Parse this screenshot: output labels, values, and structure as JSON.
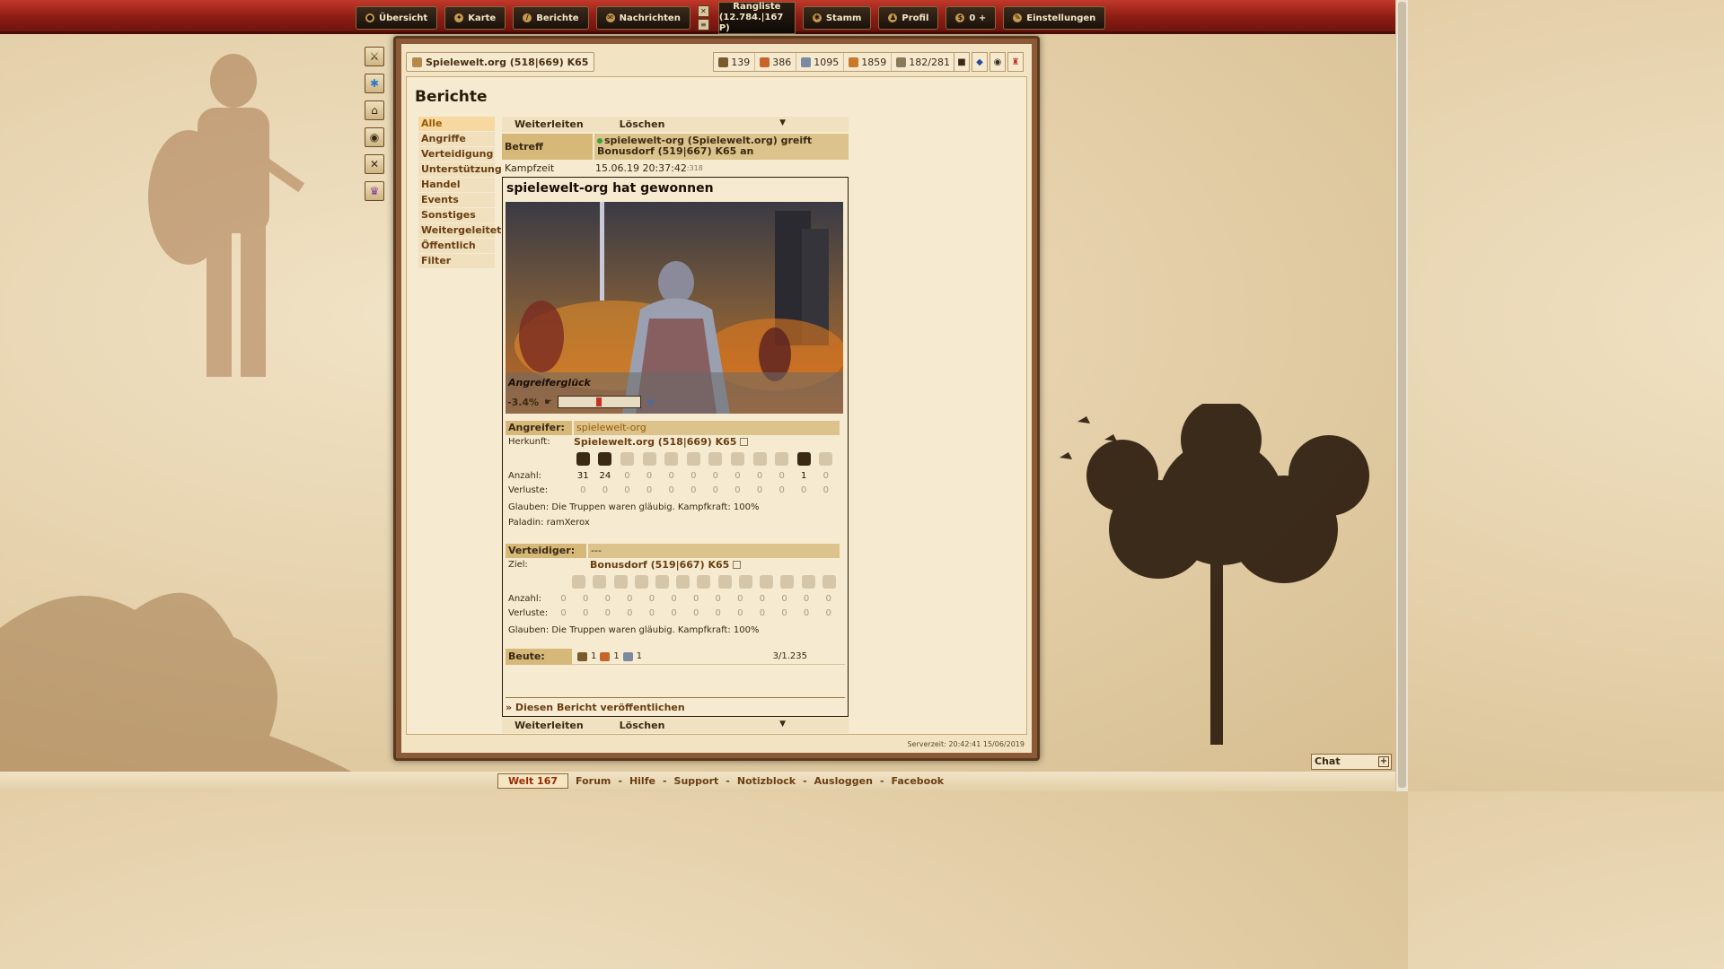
{
  "nav": {
    "overview": "Übersicht",
    "map": "Karte",
    "reports": "Berichte",
    "messages": "Nachrichten",
    "ranking_label": "Rangliste",
    "ranking_value": "(12.784.|167 P)",
    "tribe": "Stamm",
    "profile": "Profil",
    "premium": "0 +",
    "settings": "Einstellungen"
  },
  "village": {
    "name": "Spielewelt.org (518|669) K65"
  },
  "resources": {
    "wood": "139",
    "clay": "386",
    "iron": "1095",
    "storage": "1859",
    "population": "182/281"
  },
  "page": {
    "title": "Berichte"
  },
  "menu": [
    "Alle",
    "Angriffe",
    "Verteidigung",
    "Unterstützung",
    "Handel",
    "Events",
    "Sonstiges",
    "Weitergeleitet",
    "Öffentlich",
    "Filter"
  ],
  "actions": {
    "forward": "Weiterleiten",
    "delete": "Löschen"
  },
  "report": {
    "subject_label": "Betreff",
    "subject": "spielewelt-org (Spielewelt.org) greift Bonusdorf (519|667) K65 an",
    "time_label": "Kampfzeit",
    "time": "15.06.19 20:37:42",
    "time_ms": ":318",
    "winner": "spielewelt-org hat gewonnen",
    "luck_label": "Angreiferglück",
    "luck_value": "-3.4%",
    "luck_fraction": 0.466
  },
  "attacker": {
    "label": "Angreifer:",
    "name": "spielewelt-org",
    "origin_label": "Herkunft:",
    "origin": "Spielewelt.org (518|669) K65",
    "count_label": "Anzahl:",
    "loss_label": "Verluste:",
    "counts": [
      "31",
      "24",
      "0",
      "0",
      "0",
      "0",
      "0",
      "0",
      "0",
      "0",
      "1",
      "0"
    ],
    "losses": [
      "0",
      "0",
      "0",
      "0",
      "0",
      "0",
      "0",
      "0",
      "0",
      "0",
      "0",
      "0"
    ],
    "faith": "Glauben: Die Truppen waren gläubig. Kampfkraft: 100%",
    "paladin": "Paladin: ramXerox"
  },
  "defender": {
    "label": "Verteidiger:",
    "name": "---",
    "target_label": "Ziel:",
    "target": "Bonusdorf (519|667) K65",
    "count_label": "Anzahl:",
    "loss_label": "Verluste:",
    "counts": [
      "0",
      "0",
      "0",
      "0",
      "0",
      "0",
      "0",
      "0",
      "0",
      "0",
      "0",
      "0",
      "0"
    ],
    "losses": [
      "0",
      "0",
      "0",
      "0",
      "0",
      "0",
      "0",
      "0",
      "0",
      "0",
      "0",
      "0",
      "0"
    ],
    "faith": "Glauben: Die Truppen waren gläubig. Kampfkraft: 100%"
  },
  "loot": {
    "label": "Beute:",
    "wood": "1",
    "clay": "1",
    "iron": "1",
    "total": "3/1.235"
  },
  "publish": "» Diesen Bericht veröffentlichen",
  "server_time": "Serverzeit: 20:42:41 15/06/2019",
  "footer": {
    "world": "Welt 167",
    "links": [
      "Forum",
      "Hilfe",
      "Support",
      "Notizblock",
      "Ausloggen",
      "Facebook"
    ]
  },
  "chat": "Chat",
  "colors": {
    "nav_red": "#8c1c14",
    "parchment": "#f2e3c2",
    "header_gold": "#d6b878",
    "link_brown": "#6a3e12"
  }
}
